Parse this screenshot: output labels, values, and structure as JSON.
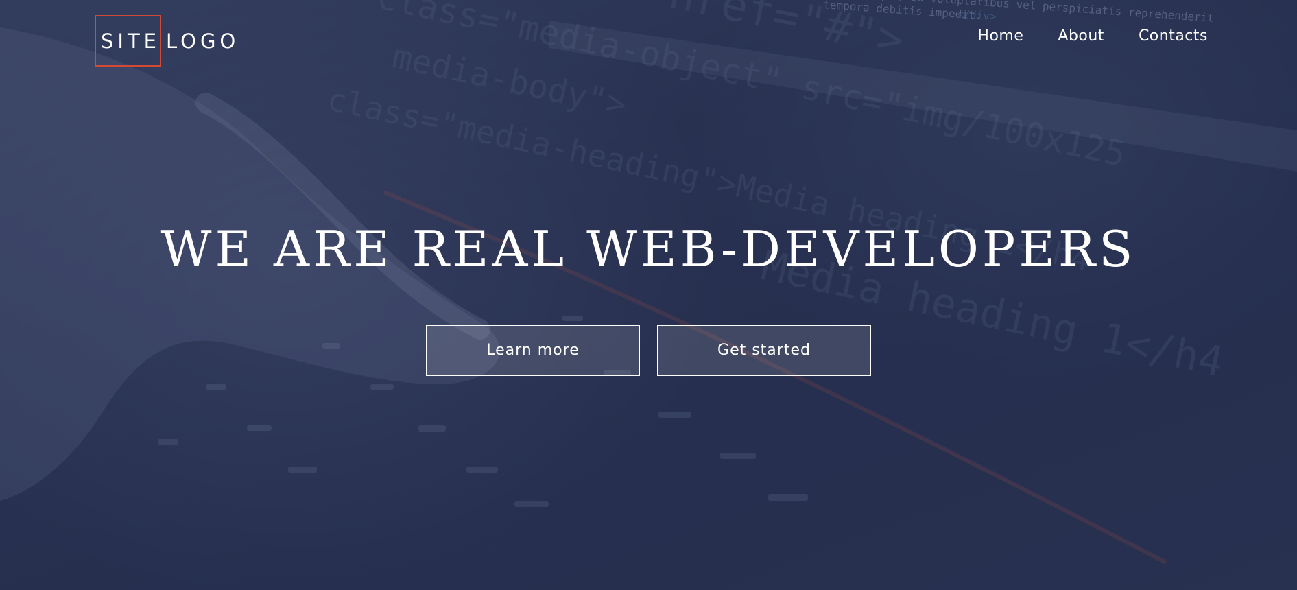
{
  "header": {
    "logo": {
      "first_word": "SITE",
      "second_word": "LOGO",
      "accent_color": "#d24a33"
    },
    "nav": [
      {
        "label": "Home"
      },
      {
        "label": "About"
      },
      {
        "label": "Contacts"
      }
    ]
  },
  "hero": {
    "title": "WE ARE REAL WEB-DEVELOPERS",
    "buttons": [
      {
        "label": "Learn more"
      },
      {
        "label": "Get started"
      }
    ],
    "background": {
      "overlay_color": "#2a3250",
      "code_lines": [
        "<a href=\"#\">",
        "class=\"media-object\" src=\"img/100x125",
        "media-body\">",
        "class=\"media-heading\">Media heading 1</h4",
        "Media heading 1</h4"
      ],
      "small_code_lines": [
        ", cumque, ad voluptatibus vel perspiciatis reprehenderit",
        "tempora debitis impedit.",
        "</div>"
      ]
    }
  }
}
